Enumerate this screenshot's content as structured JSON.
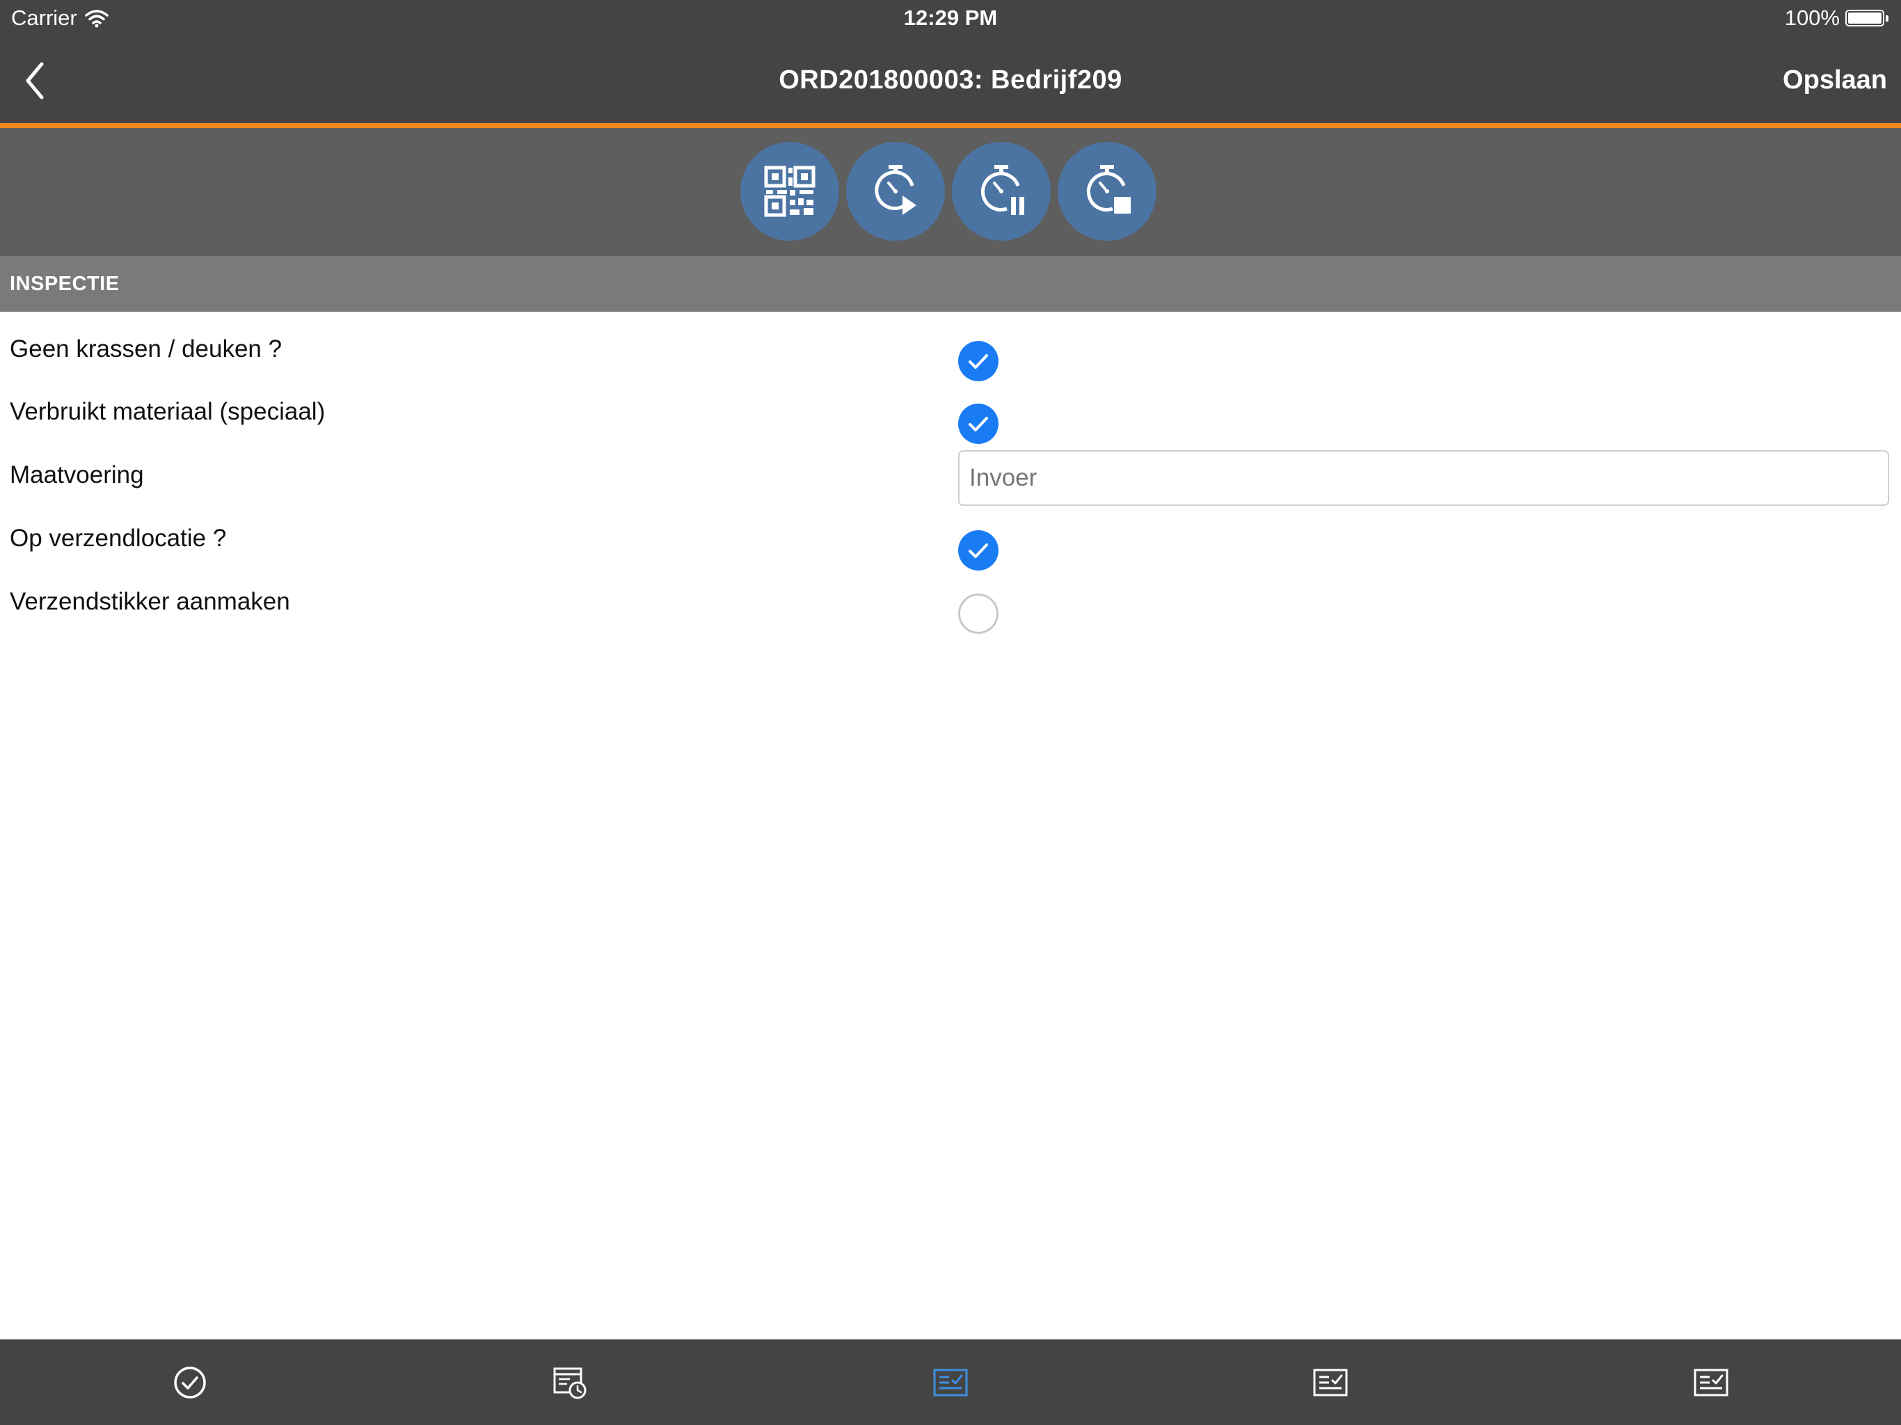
{
  "status_bar": {
    "carrier": "Carrier",
    "time": "12:29 PM",
    "battery": "100%"
  },
  "nav": {
    "title": "ORD201800003: Bedrijf209",
    "save_label": "Opslaan",
    "back_icon": "chevron-left-icon"
  },
  "toolbar": {
    "buttons": [
      {
        "icon": "qr-code-icon"
      },
      {
        "icon": "stopwatch-start-icon"
      },
      {
        "icon": "stopwatch-pause-icon"
      },
      {
        "icon": "stopwatch-stop-icon"
      }
    ],
    "button_color": "#4c74a3"
  },
  "section": {
    "title": "INSPECTIE"
  },
  "form": {
    "rows": [
      {
        "label": "Geen krassen / deuken ?",
        "type": "checkbox",
        "checked": true
      },
      {
        "label": "Verbruikt materiaal (speciaal)",
        "type": "checkbox",
        "checked": true
      },
      {
        "label": "Maatvoering",
        "type": "text",
        "value": "",
        "placeholder": "Invoer"
      },
      {
        "label": "Op verzendlocatie ?",
        "type": "checkbox",
        "checked": true
      },
      {
        "label": "Verzendstikker aanmaken",
        "type": "checkbox",
        "checked": false
      }
    ]
  },
  "tab_bar": {
    "tabs": [
      {
        "icon": "checkmark-circle-icon",
        "active": false
      },
      {
        "icon": "calendar-clock-icon",
        "active": false
      },
      {
        "icon": "checklist-icon",
        "active": true
      },
      {
        "icon": "checklist-icon",
        "active": false
      },
      {
        "icon": "checklist-icon",
        "active": false
      }
    ]
  },
  "colors": {
    "bar_background": "#444444",
    "accent_orange": "#f2881b",
    "checkbox_blue": "#1a7cf5",
    "section_header": "#7a7a7a",
    "active_tab": "#3d8fe0"
  }
}
